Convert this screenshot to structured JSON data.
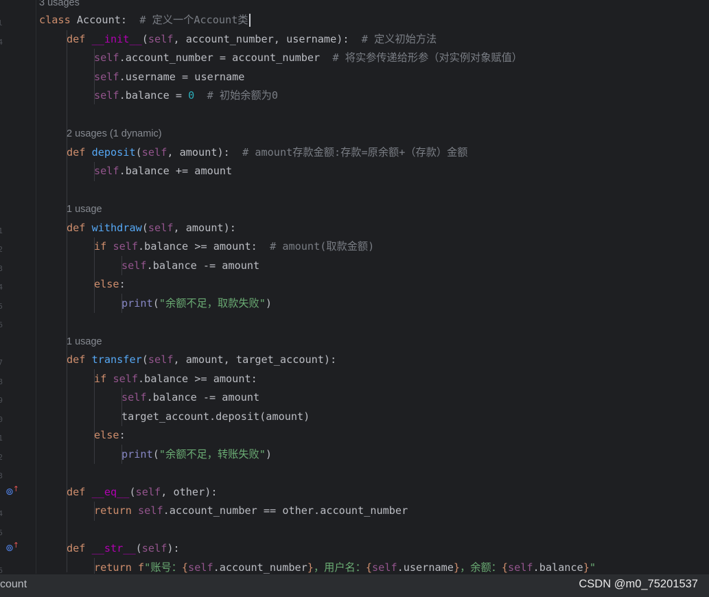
{
  "hints": {
    "class_usages": "3 usages",
    "deposit_usages": "2 usages (1 dynamic)",
    "withdraw_usages": "1 usage",
    "transfer_usages": "1 usage"
  },
  "code": {
    "l1": {
      "kw": "class",
      "rest": " Account:  ",
      "cm": "# 定义一个Account类"
    },
    "l2": {
      "kw": "def",
      "fn": "__init__",
      "p1": "(",
      "self": "self",
      ",": ", account_number, username):  ",
      "cm": "# 定义初始方法"
    },
    "l3": {
      "self": "self",
      ".rest": ".account_number = account_number  ",
      "cm": "# 将实参传递给形参（对实例对象赋值）"
    },
    "l4": {
      "self": "self",
      ".rest": ".username = username"
    },
    "l5": {
      "self": "self",
      ".rest": ".balance = ",
      "num": "0",
      "sp": "  ",
      "cm": "# 初始余额为0"
    },
    "l7": {
      "kw": "def",
      "fn": "deposit",
      "p1": "(",
      "self": "self",
      "rest": ", amount):  ",
      "cm": "# amount存款金额:存款=原余额+（存款）金额"
    },
    "l8": {
      "self": "self",
      "rest": ".balance += amount"
    },
    "l10": {
      "kw": "def",
      "fn": "withdraw",
      "p1": "(",
      "self": "self",
      "rest": ", amount):"
    },
    "l11": {
      "kw": "if",
      "self": "self",
      "rest": ".balance >= amount:  ",
      "cm": "# amount(取款金额)"
    },
    "l12": {
      "self": "self",
      "rest": ".balance -= amount"
    },
    "l13": {
      "kw": "else",
      "rest": ":"
    },
    "l14": {
      "fn": "print",
      "p1": "(",
      "str": "\"余额不足，取款失败\"",
      "p2": ")"
    },
    "l16": {
      "kw": "def",
      "fn": "transfer",
      "p1": "(",
      "self": "self",
      "rest": ", amount, target_account):"
    },
    "l17": {
      "kw": "if",
      "self": "self",
      "rest": ".balance >= amount:"
    },
    "l18": {
      "self": "self",
      "rest": ".balance -= amount"
    },
    "l19": {
      "rest": "target_account.deposit(amount)"
    },
    "l20": {
      "kw": "else",
      "rest": ":"
    },
    "l21": {
      "fn": "print",
      "p1": "(",
      "str": "\"余额不足，转账失败\"",
      "p2": ")"
    },
    "l23": {
      "kw": "def",
      "fn": "__eq__",
      "p1": "(",
      "self": "self",
      "rest": ", other):"
    },
    "l24": {
      "kw": "return",
      "self": "self",
      "rest": ".account_number == other.account_number"
    },
    "l26": {
      "kw": "def",
      "fn": "__str__",
      "p1": "(",
      "self": "self",
      "rest": "):"
    },
    "l27": {
      "kw": "return",
      "pre": " f",
      "s1": "\"账号：",
      "b1": "{",
      "self1": "self",
      "r1": ".account_number",
      "b2": "}",
      "s2": "，用户名：",
      "b3": "{",
      "self2": "self",
      "r2": ".username",
      "b4": "}",
      "s3": "，余额：",
      "b5": "{",
      "self3": "self",
      "r3": ".balance",
      "b6": "}",
      "s4": "\""
    }
  },
  "gutter": {
    "override_icon": "override-method-icon",
    "override_glyph": "⊚",
    "override_arrow": "↑",
    "marks": [
      "l",
      "4",
      "1",
      "2",
      "3",
      "4",
      "5",
      "6",
      "7",
      "8",
      "9",
      "0",
      "1",
      "2",
      "3",
      "4",
      "5",
      "6",
      "7"
    ]
  },
  "status": {
    "left": "count",
    "watermark": "CSDN @m0_75201537"
  },
  "colors": {
    "background": "#1e1f22",
    "keyword": "#cf8e6d",
    "self": "#94558d",
    "function": "#56a8f5",
    "comment": "#7a7e85",
    "string": "#6aab73",
    "number": "#2aacb8",
    "builtin": "#8888c6"
  }
}
